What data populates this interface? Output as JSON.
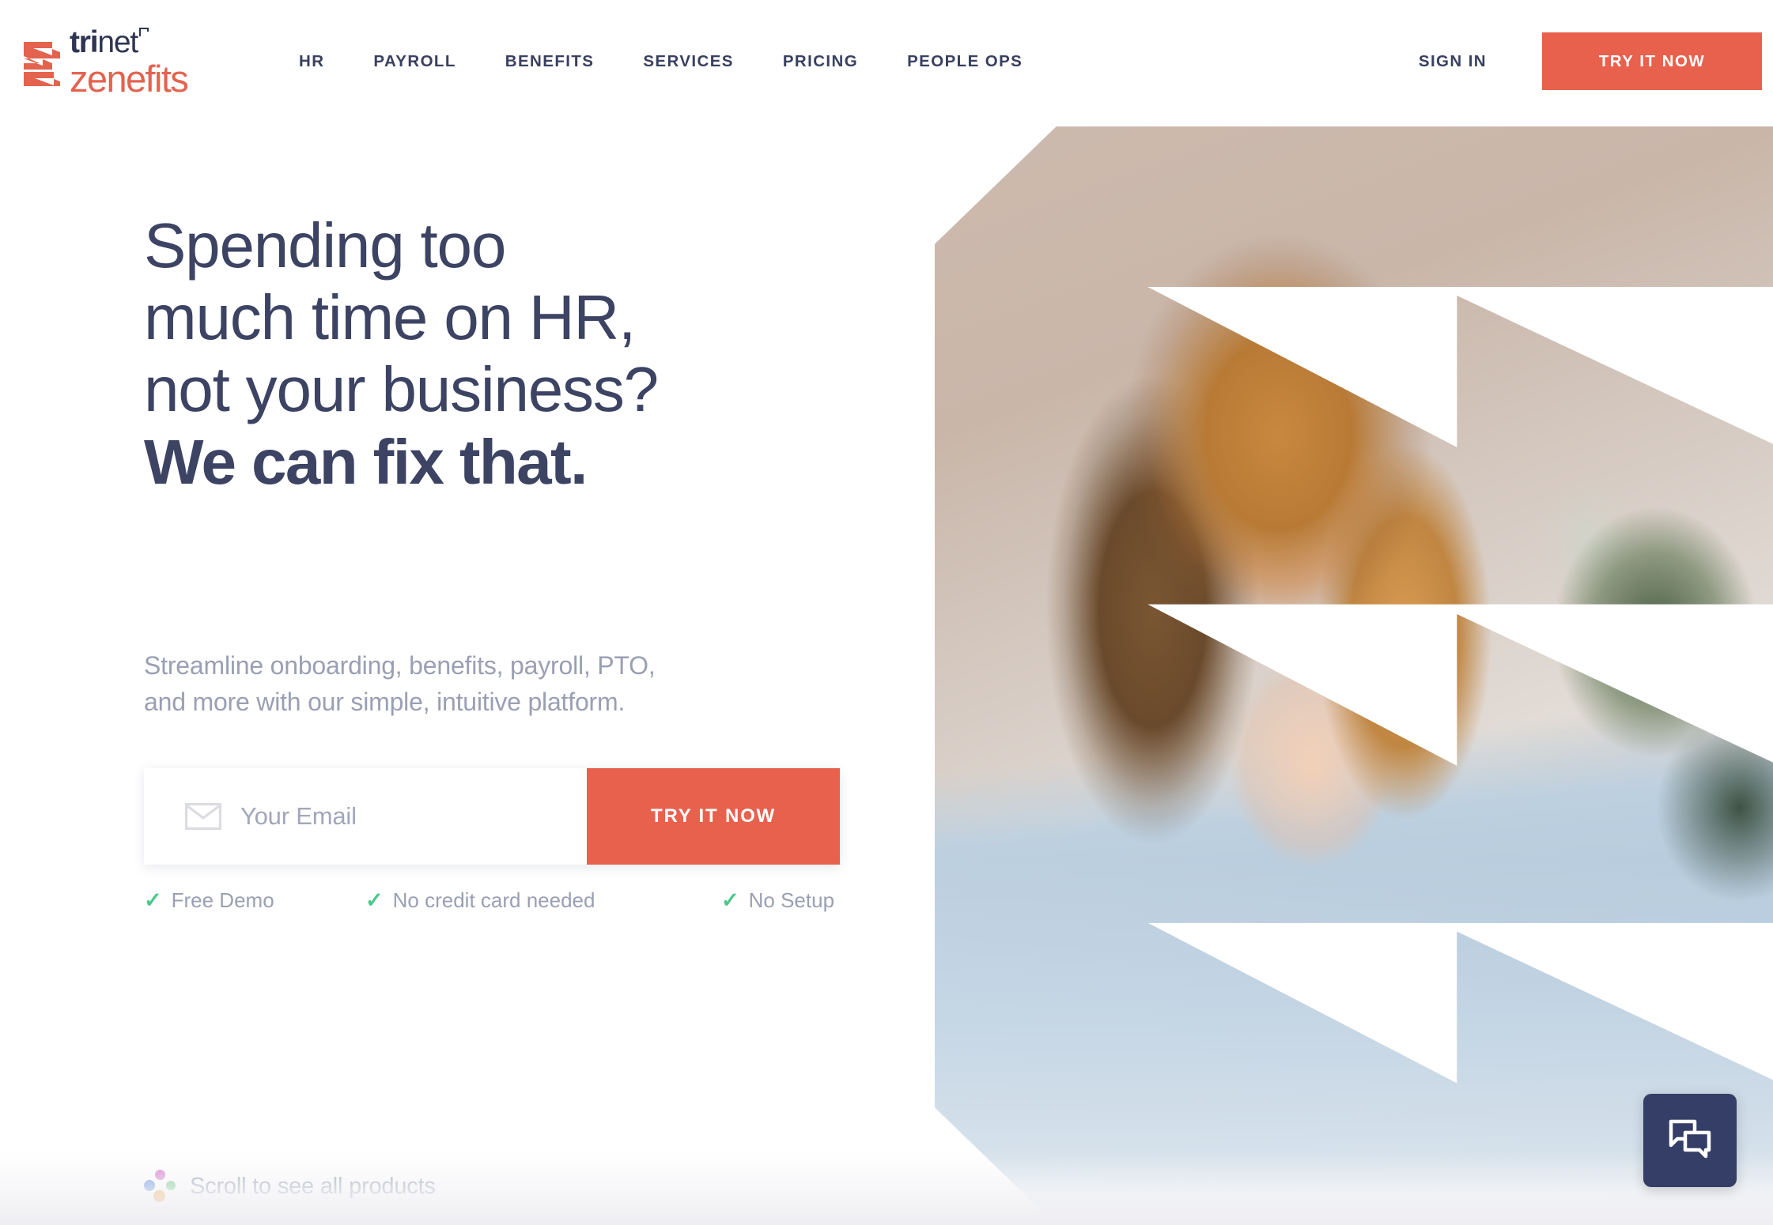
{
  "header": {
    "logo": {
      "mark_icon": "zenefits-z-mark-icon",
      "trinet_text": "trinet",
      "trinet_bold_part": "tri",
      "trinet_rest": "net",
      "trademark": "⌐",
      "zenefits_text": "zenefits",
      "mark_color": "#E3634F",
      "trinet_color": "#2E3452",
      "zenefits_color": "#E3634F"
    },
    "nav_items": [
      {
        "label": "HR"
      },
      {
        "label": "PAYROLL"
      },
      {
        "label": "BENEFITS"
      },
      {
        "label": "SERVICES"
      },
      {
        "label": "PRICING"
      },
      {
        "label": "PEOPLE OPS"
      }
    ],
    "sign_in_label": "SIGN IN",
    "cta_label": "TRY IT NOW",
    "cta_color": "#E8614D"
  },
  "hero": {
    "headline_line1": "Spending too",
    "headline_line2": "much time on HR,",
    "headline_line3": "not your business?",
    "headline_bold": "We can fix that.",
    "headline_color": "#3C4363",
    "subhead_line1": "Streamline onboarding, benefits, payroll, PTO,",
    "subhead_line2": "and more with our simple, intuitive platform.",
    "subhead_color": "#9A9FB3",
    "image_alt": "smiling-woman-in-denim-shirt"
  },
  "form": {
    "email_icon": "envelope-icon",
    "email_placeholder": "Your Email",
    "email_value": "",
    "submit_label": "TRY IT NOW",
    "submit_color": "#E8614D"
  },
  "features": [
    {
      "check_icon": "check-icon",
      "label": "Free Demo"
    },
    {
      "check_icon": "check-icon",
      "label": "No credit card needed"
    },
    {
      "check_icon": "check-icon",
      "label": "No Setup"
    }
  ],
  "feature_check_color": "#4CC88A",
  "scroll_hint": {
    "label": "Scroll to see all products",
    "dots_icon": "four-color-dots-icon",
    "dot_colors": [
      "#D983D0",
      "#6691DD",
      "#77C88E",
      "#EE9C33"
    ]
  },
  "chat": {
    "icon": "chat-bubbles-icon",
    "background": "#343E66"
  }
}
